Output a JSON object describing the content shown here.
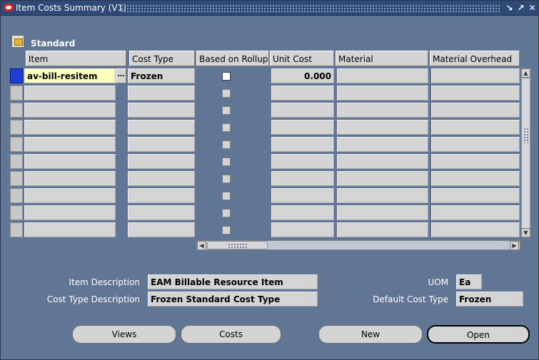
{
  "window": {
    "title": "Item Costs Summary (V1)"
  },
  "block": {
    "title": "Standard"
  },
  "columns": {
    "item": "Item",
    "cost_type": "Cost Type",
    "based_on_rollup": "Based on Rollup",
    "unit_cost": "Unit Cost",
    "material": "Material",
    "material_overhead": "Material Overhead"
  },
  "rows": [
    {
      "item": "av-bill-resitem",
      "cost_type": "Frozen",
      "based_on_rollup": true,
      "unit_cost": "0.000",
      "material": "",
      "material_overhead": "",
      "current": true
    },
    {
      "item": "",
      "cost_type": "",
      "based_on_rollup": false,
      "unit_cost": "",
      "material": "",
      "material_overhead": ""
    },
    {
      "item": "",
      "cost_type": "",
      "based_on_rollup": false,
      "unit_cost": "",
      "material": "",
      "material_overhead": ""
    },
    {
      "item": "",
      "cost_type": "",
      "based_on_rollup": false,
      "unit_cost": "",
      "material": "",
      "material_overhead": ""
    },
    {
      "item": "",
      "cost_type": "",
      "based_on_rollup": false,
      "unit_cost": "",
      "material": "",
      "material_overhead": ""
    },
    {
      "item": "",
      "cost_type": "",
      "based_on_rollup": false,
      "unit_cost": "",
      "material": "",
      "material_overhead": ""
    },
    {
      "item": "",
      "cost_type": "",
      "based_on_rollup": false,
      "unit_cost": "",
      "material": "",
      "material_overhead": ""
    },
    {
      "item": "",
      "cost_type": "",
      "based_on_rollup": false,
      "unit_cost": "",
      "material": "",
      "material_overhead": ""
    },
    {
      "item": "",
      "cost_type": "",
      "based_on_rollup": false,
      "unit_cost": "",
      "material": "",
      "material_overhead": ""
    },
    {
      "item": "",
      "cost_type": "",
      "based_on_rollup": false,
      "unit_cost": "",
      "material": "",
      "material_overhead": ""
    }
  ],
  "details": {
    "item_description_label": "Item Description",
    "item_description": "EAM Billable Resource Item",
    "cost_type_description_label": "Cost Type Description",
    "cost_type_description": "Frozen Standard Cost Type",
    "uom_label": "UOM",
    "uom": "Ea",
    "default_cost_type_label": "Default Cost Type",
    "default_cost_type": "Frozen"
  },
  "buttons": {
    "views": "Views",
    "costs": "Costs",
    "new": "New",
    "open": "Open"
  },
  "icons": {
    "title_logo": "oracle-logo-icon",
    "folder": "folder-icon",
    "minimize": "minimize-icon",
    "maximize": "maximize-icon",
    "close": "close-icon"
  },
  "colors": {
    "canvas": "#617595",
    "titlebar": "#304a78",
    "current_record": "#1e3ed6",
    "active_field": "#ffffc0"
  }
}
